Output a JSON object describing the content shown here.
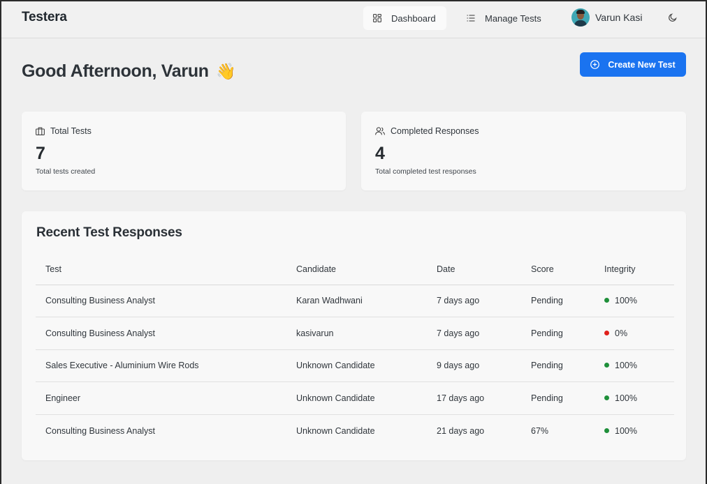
{
  "header": {
    "brand": "Testera",
    "nav": [
      {
        "label": "Dashboard",
        "icon": "grid-icon",
        "active": true
      },
      {
        "label": "Manage Tests",
        "icon": "list-icon",
        "active": false
      }
    ],
    "user_name": "Varun Kasi",
    "theme_icon": "moon-icon"
  },
  "main": {
    "greeting": "Good Afternoon, Varun",
    "greeting_emoji": "👋",
    "create_button": "Create New Test",
    "accent_color": "#1a73f0"
  },
  "stats": [
    {
      "label": "Total Tests",
      "value": "7",
      "sub": "Total tests created",
      "icon": "briefcase-icon"
    },
    {
      "label": "Completed Responses",
      "value": "4",
      "sub": "Total completed test responses",
      "icon": "users-icon"
    }
  ],
  "recent": {
    "title": "Recent Test Responses",
    "columns": [
      "Test",
      "Candidate",
      "Date",
      "Score",
      "Integrity"
    ],
    "rows": [
      {
        "test": "Consulting Business Analyst",
        "candidate": "Karan Wadhwani",
        "date": "7 days ago",
        "score": "Pending",
        "integrity": "100%",
        "status_color": "#1f8f3a"
      },
      {
        "test": "Consulting Business Analyst",
        "candidate": "kasivarun",
        "date": "7 days ago",
        "score": "Pending",
        "integrity": "0%",
        "status_color": "#e0201b"
      },
      {
        "test": "Sales Executive - Aluminium Wire Rods",
        "candidate": "Unknown Candidate",
        "date": "9 days ago",
        "score": "Pending",
        "integrity": "100%",
        "status_color": "#1f8f3a"
      },
      {
        "test": "Engineer",
        "candidate": "Unknown Candidate",
        "date": "17 days ago",
        "score": "Pending",
        "integrity": "100%",
        "status_color": "#1f8f3a"
      },
      {
        "test": "Consulting Business Analyst",
        "candidate": "Unknown Candidate",
        "date": "21 days ago",
        "score": "67%",
        "integrity": "100%",
        "status_color": "#1f8f3a"
      }
    ]
  }
}
